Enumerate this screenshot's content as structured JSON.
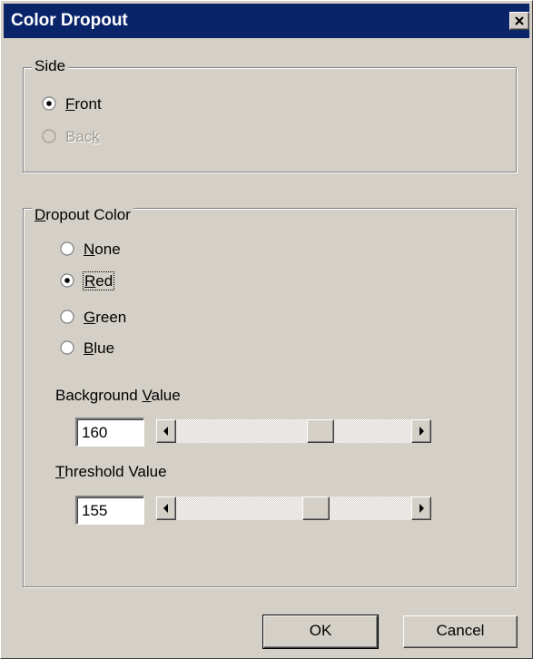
{
  "window": {
    "title": "Color Dropout",
    "close_icon": "close-x-icon"
  },
  "side": {
    "legend": "Side",
    "options": [
      {
        "label_pre": "",
        "mnemonic": "F",
        "label_post": "ront",
        "selected": true,
        "enabled": true
      },
      {
        "label_pre": "Bac",
        "mnemonic": "k",
        "label_post": "",
        "selected": false,
        "enabled": false
      }
    ]
  },
  "dropout": {
    "legend_mnemonic": "D",
    "legend_rest": "ropout Color",
    "options": [
      {
        "mnemonic": "N",
        "label_post": "one",
        "selected": false
      },
      {
        "mnemonic": "R",
        "label_post": "ed",
        "selected": true
      },
      {
        "mnemonic": "G",
        "label_post": "reen",
        "selected": false
      },
      {
        "mnemonic": "B",
        "label_post": "lue",
        "selected": false
      }
    ],
    "background": {
      "label_pre": "Background ",
      "mnemonic": "V",
      "label_post": "alue",
      "value": "160",
      "slider_min": 0,
      "slider_max": 255,
      "slider_value": 160
    },
    "threshold": {
      "label_pre": "",
      "mnemonic": "T",
      "label_post": "hreshold Value",
      "value": "155",
      "slider_min": 0,
      "slider_max": 255,
      "slider_value": 155
    }
  },
  "buttons": {
    "ok": "OK",
    "cancel": "Cancel"
  },
  "colors": {
    "face": "#d4d0c8",
    "titlebar": "#0a246a",
    "disabled_text": "#a09c94"
  }
}
